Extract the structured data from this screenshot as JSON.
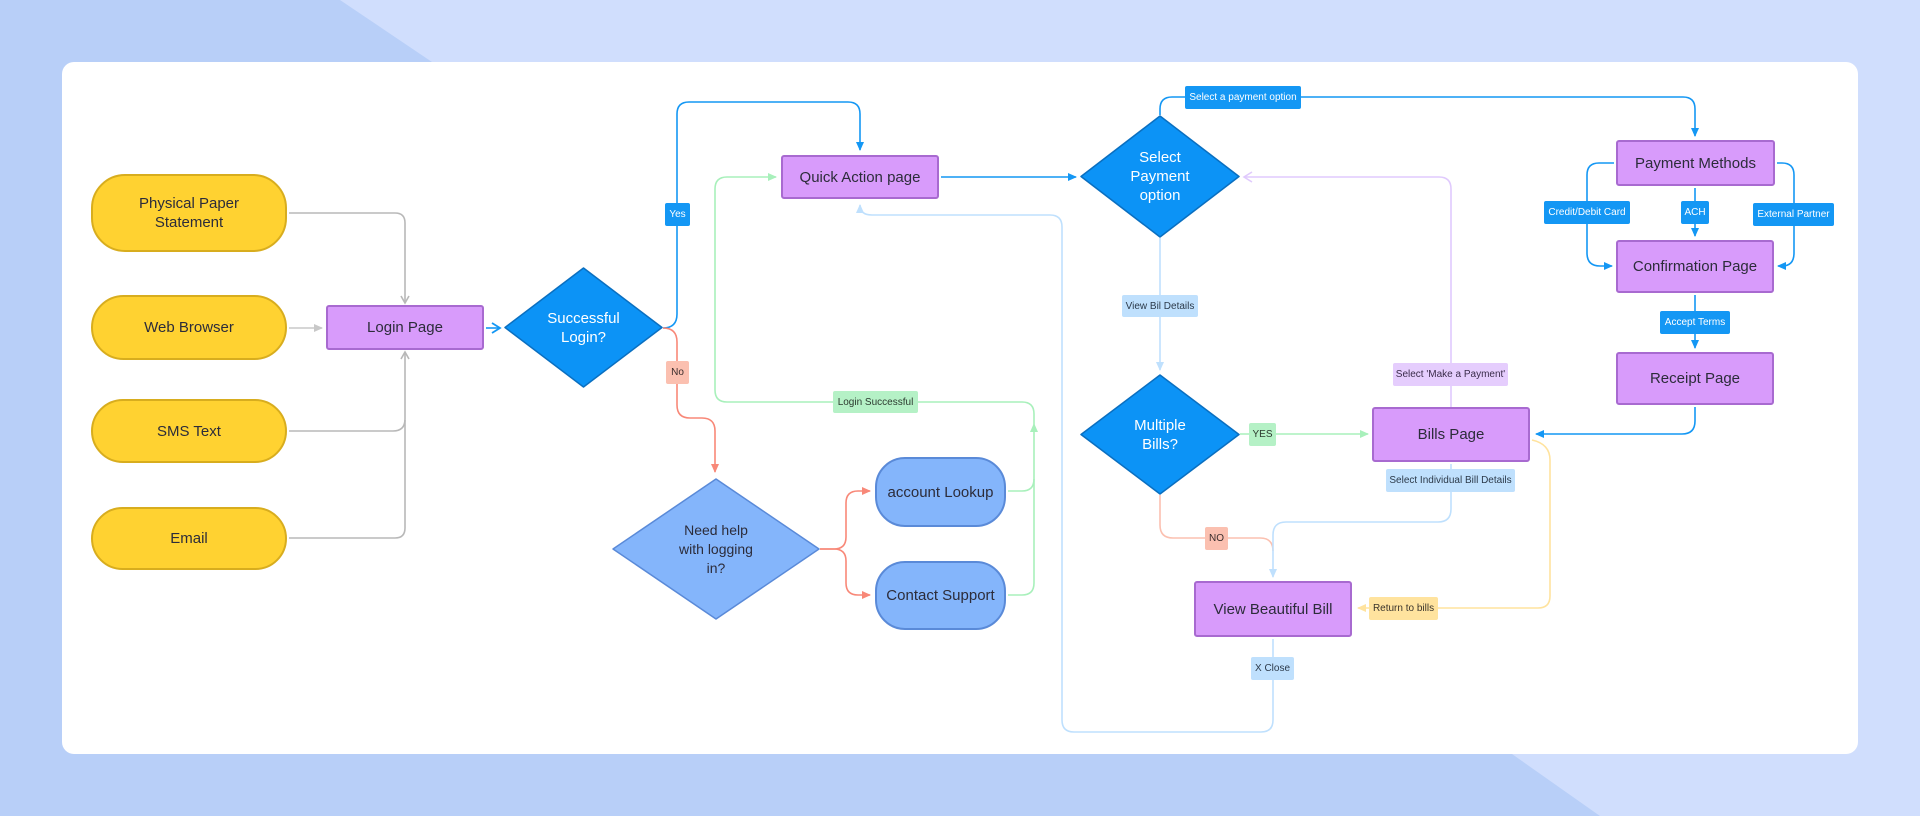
{
  "colors": {
    "background": "#b8cff8",
    "background_light": "#d0defd",
    "card": "#ffffff",
    "source_pill": "#ffd231",
    "page_box": "#d89bfb",
    "decision": "#0c93f6",
    "help_decision": "#84b5fb",
    "connector_gray": "#b8b8b8",
    "connector_blue": "#1497f4",
    "connector_red": "#f88878",
    "connector_green": "#a8f0bb",
    "connector_lightblue": "#bfe0fd",
    "connector_purple": "#e0cafd",
    "connector_yellow": "#ffe39e"
  },
  "nodes": {
    "physical_paper": "Physical Paper Statement",
    "web_browser": "Web Browser",
    "sms_text": "SMS Text",
    "email": "Email",
    "login_page": "Login Page",
    "successful_login": "Successful Login?",
    "quick_action": "Quick Action page",
    "need_help": "Need help with logging in?",
    "account_lookup": "account Lookup",
    "contact_support": "Contact Support",
    "select_payment": "Select Payment option",
    "multiple_bills": "Multiple Bills?",
    "bills_page": "Bills Page",
    "view_bill": "View Beautiful Bill",
    "payment_methods": "Payment Methods",
    "confirmation": "Confirmation Page",
    "receipt": "Receipt Page"
  },
  "edge_labels": {
    "yes": "Yes",
    "no": "No",
    "login_successful": "Login Successful",
    "select_payment_option": "Select a payment option",
    "view_bill_details": "View Bil Details",
    "multi_yes": "YES",
    "multi_no": "NO",
    "select_make_payment": "Select 'Make a Payment'",
    "select_individual": "Select Individual Bill Details",
    "return_to_bills": "Return to bills",
    "x_close": "X Close",
    "credit_debit": "Credit/Debit Card",
    "ach": "ACH",
    "external_partner": "External Partner",
    "accept_terms": "Accept Terms"
  }
}
